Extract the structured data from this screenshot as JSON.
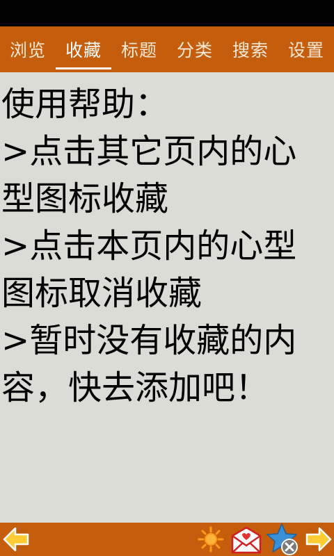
{
  "tabs": [
    {
      "label": "浏览",
      "active": false
    },
    {
      "label": "收藏",
      "active": true
    },
    {
      "label": "标题",
      "active": false
    },
    {
      "label": "分类",
      "active": false
    },
    {
      "label": "搜索",
      "active": false
    },
    {
      "label": "设置",
      "active": false
    }
  ],
  "content": {
    "help_text": "使用帮助：\n>点击其它页内的心型图标收藏\n>点击本页内的心型图标取消收藏\n>暂时没有收藏的内容，快去添加吧！"
  },
  "bottom_bar": {
    "icons": [
      "back-arrow-icon",
      "brightness-icon",
      "mail-icon",
      "favorite-remove-icon",
      "forward-arrow-icon"
    ]
  },
  "colors": {
    "status_bar": "#000000",
    "accent_bar": "#c45e0d",
    "background": "#dcdcd6",
    "arrow": "#ffcc33",
    "sun": "#ff9a1f",
    "star": "#3a8fd6"
  }
}
